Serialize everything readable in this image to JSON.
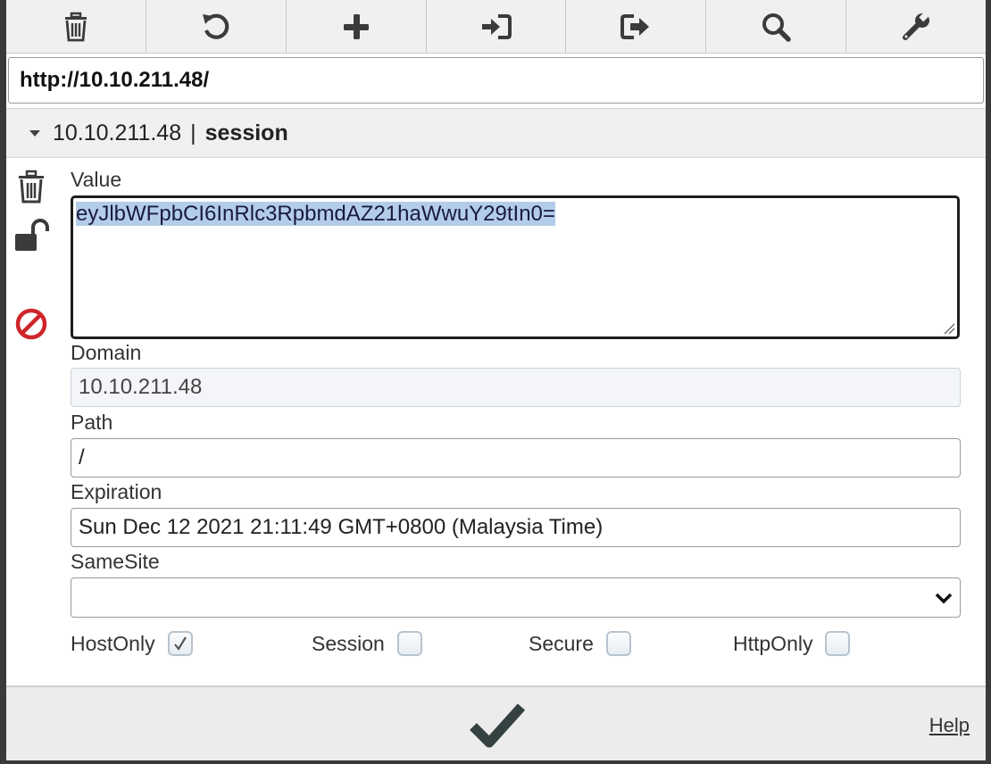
{
  "toolbar": {
    "buttons": [
      {
        "name": "delete-all",
        "icon": "trash-icon"
      },
      {
        "name": "reset",
        "icon": "undo-icon"
      },
      {
        "name": "add",
        "icon": "plus-icon"
      },
      {
        "name": "import",
        "icon": "import-icon"
      },
      {
        "name": "export",
        "icon": "export-icon"
      },
      {
        "name": "search",
        "icon": "search-icon"
      },
      {
        "name": "options",
        "icon": "wrench-icon"
      }
    ]
  },
  "url": "http://10.10.211.48/",
  "cookie": {
    "domain_header": "10.10.211.48",
    "separator": "|",
    "name": "session"
  },
  "side_icons": [
    "trash-icon",
    "unlock-icon",
    "block-icon"
  ],
  "form": {
    "value_label": "Value",
    "value": "eyJlbWFpbCI6InRlc3RpbmdAZ21haWwuY29tIn0=",
    "domain_label": "Domain",
    "domain": "10.10.211.48",
    "path_label": "Path",
    "path": "/",
    "expiration_label": "Expiration",
    "expiration": "Sun Dec 12 2021 21:11:49 GMT+0800 (Malaysia Time)",
    "samesite_label": "SameSite",
    "samesite": ""
  },
  "flags": [
    {
      "label": "HostOnly",
      "checked": true
    },
    {
      "label": "Session",
      "checked": false
    },
    {
      "label": "Secure",
      "checked": false
    },
    {
      "label": "HttpOnly",
      "checked": false
    }
  ],
  "footer": {
    "save_icon": "checkmark-icon",
    "help_label": "Help"
  },
  "colors": {
    "icon": "#3b3b3b",
    "block": "#d0242b",
    "selection": "#b3cde8"
  }
}
